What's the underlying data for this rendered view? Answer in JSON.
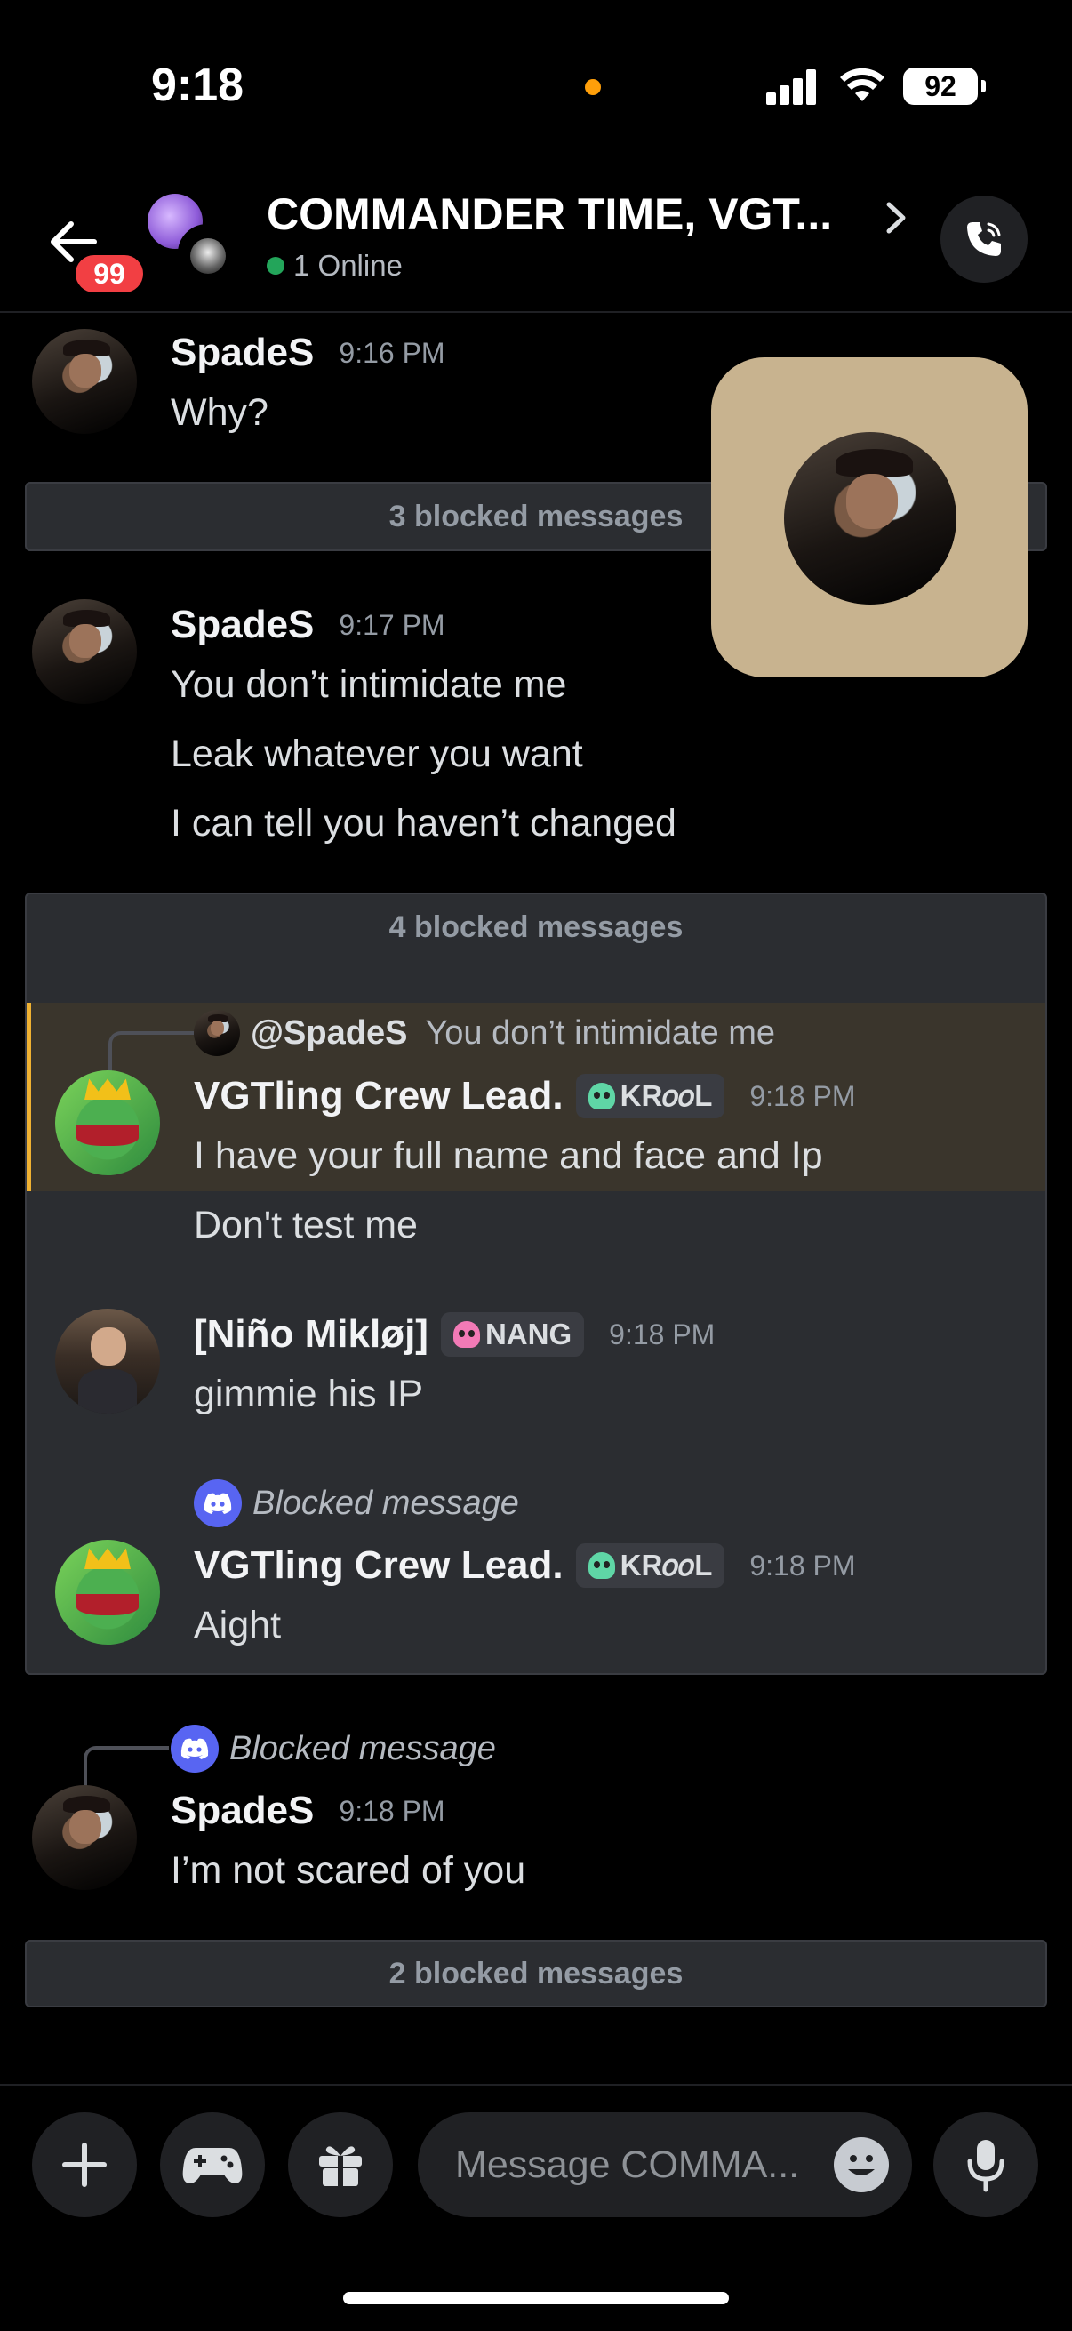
{
  "status_bar": {
    "time": "9:18",
    "battery": "92"
  },
  "header": {
    "unread_badge": "99",
    "title": "COMMANDER TIME, VGT...",
    "online_status": "1 Online"
  },
  "messages": {
    "m1": {
      "author": "SpadeS",
      "time": "9:16 PM",
      "lines": [
        "Why?"
      ]
    },
    "blocked1": "3 blocked messages",
    "m2": {
      "author": "SpadeS",
      "time": "9:17 PM",
      "lines": [
        "You don’t intimidate me",
        "Leak whatever you want",
        "I can tell you haven’t changed"
      ]
    },
    "blocked2": "4 blocked messages",
    "m3": {
      "reply_to": "@SpadeS",
      "reply_text": "You don’t intimidate me",
      "author": "VGTling Crew Lead.",
      "tag": "KR𝜊𝜊L",
      "time": "9:18 PM",
      "lines": [
        "I have your full name and face and Ip",
        "Don't test me"
      ]
    },
    "m4": {
      "author": "[Niño Mikløj]",
      "tag": "NANG",
      "time": "9:18 PM",
      "lines": [
        "gimmie his IP"
      ]
    },
    "m5": {
      "reply_text": "Blocked message",
      "author": "VGTling Crew Lead.",
      "tag": "KR𝜊𝜊L",
      "time": "9:18 PM",
      "lines": [
        "Aight"
      ]
    },
    "m6": {
      "reply_text": "Blocked message",
      "author": "SpadeS",
      "time": "9:18 PM",
      "lines": [
        "I’m not scared of you"
      ]
    },
    "blocked3": "2 blocked messages"
  },
  "composer": {
    "placeholder": "Message COMMA..."
  },
  "colors": {
    "accent": "#5865f2",
    "online": "#23a55a",
    "badge": "#f23f43",
    "highlight_bar": "#f0b232"
  },
  "icons": [
    "back-arrow-icon",
    "chevron-right-icon",
    "phone-call-icon",
    "plus-icon",
    "gamepad-icon",
    "gift-icon",
    "emoji-icon",
    "microphone-icon",
    "discord-icon",
    "skull-icon"
  ]
}
